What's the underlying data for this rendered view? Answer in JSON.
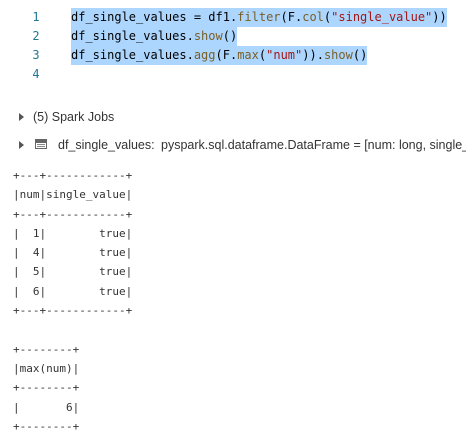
{
  "code_cell": {
    "lines": [
      {
        "number": "1",
        "selected": true,
        "tokens": [
          {
            "type": "plain",
            "text": "df_single_values = df1."
          },
          {
            "type": "fn",
            "text": "filter"
          },
          {
            "type": "plain",
            "text": "(F."
          },
          {
            "type": "fn",
            "text": "col"
          },
          {
            "type": "plain",
            "text": "("
          },
          {
            "type": "str",
            "text": "\"single_value\""
          },
          {
            "type": "plain",
            "text": "))"
          }
        ]
      },
      {
        "number": "2",
        "selected": true,
        "tokens": [
          {
            "type": "plain",
            "text": "df_single_values."
          },
          {
            "type": "fn",
            "text": "show"
          },
          {
            "type": "plain",
            "text": "()"
          }
        ]
      },
      {
        "number": "3",
        "selected": true,
        "tokens": [
          {
            "type": "plain",
            "text": "df_single_values."
          },
          {
            "type": "fn",
            "text": "agg"
          },
          {
            "type": "plain",
            "text": "(F."
          },
          {
            "type": "fn",
            "text": "max"
          },
          {
            "type": "plain",
            "text": "("
          },
          {
            "type": "str",
            "text": "\"num\""
          },
          {
            "type": "plain",
            "text": "))."
          },
          {
            "type": "fn",
            "text": "show"
          },
          {
            "type": "plain",
            "text": "()"
          }
        ]
      },
      {
        "number": "4",
        "selected": false,
        "tokens": []
      }
    ]
  },
  "spark_jobs": {
    "label": "(5) Spark Jobs"
  },
  "dataframe_info": {
    "name": "df_single_values:",
    "type": "pyspark.sql.dataframe.DataFrame = [num: long, single_value: boolean]"
  },
  "output_text": "+---+------------+\n|num|single_value|\n+---+------------+\n|  1|        true|\n|  4|        true|\n|  5|        true|\n|  6|        true|\n+---+------------+\n\n+--------+\n|max(num)|\n+--------+\n|       6|\n+--------+",
  "colors": {
    "selection": "#add6ff",
    "line_number": "#237893",
    "function": "#795e26",
    "string": "#a31515"
  },
  "icons": {
    "expand": "chevron-right-icon",
    "dataframe": "table-icon"
  }
}
